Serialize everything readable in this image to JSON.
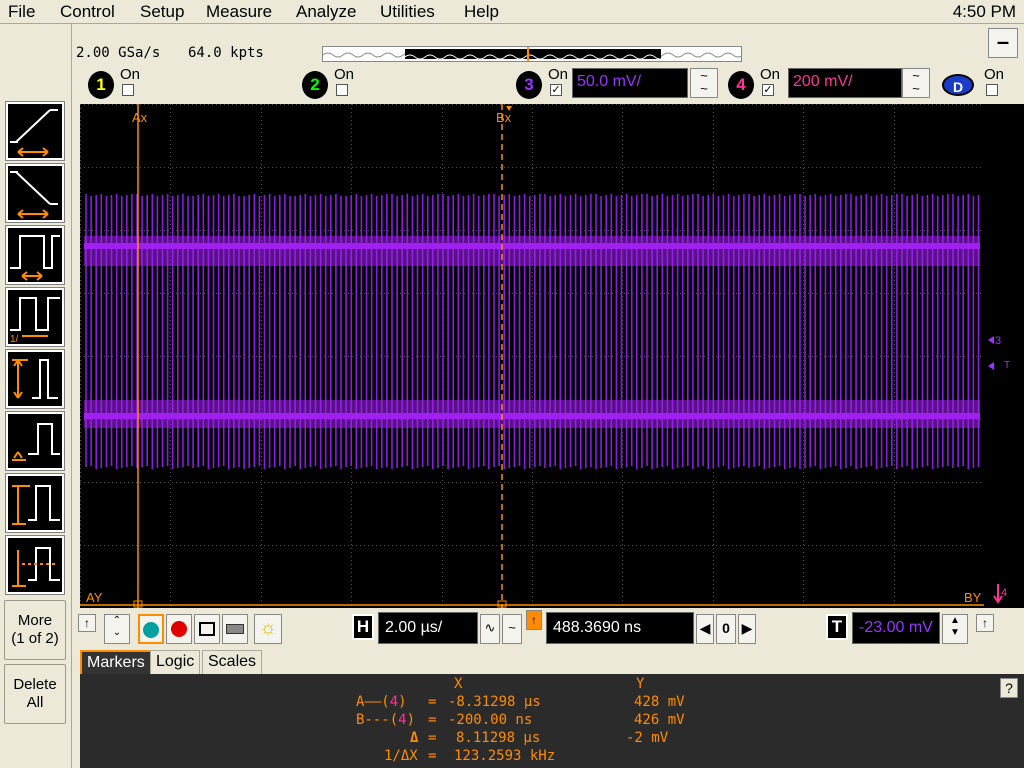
{
  "menu": {
    "items": [
      "File",
      "Control",
      "Setup",
      "Measure",
      "Analyze",
      "Utilities",
      "Help"
    ],
    "clock": "4:50 PM"
  },
  "acquisition": {
    "rate": "2.00 GSa/s",
    "points": "64.0 kpts",
    "minimize": "–"
  },
  "channels": [
    {
      "num": "1",
      "on_label": "On",
      "checked": false,
      "color": "#ffff00"
    },
    {
      "num": "2",
      "on_label": "On",
      "checked": false,
      "color": "#00ff00"
    },
    {
      "num": "3",
      "on_label": "On",
      "checked": true,
      "scale": "50.0 mV/",
      "color": "#9933ff"
    },
    {
      "num": "4",
      "on_label": "On",
      "checked": true,
      "scale": "200 mV/",
      "color": "#ff3399"
    }
  ],
  "digital": {
    "label": "D",
    "on_label": "On",
    "checked": false
  },
  "coupling_glyph": "~",
  "left_toolbar": {
    "modes": [
      "rising-edge-mode",
      "falling-edge-mode",
      "pulse-width-mode",
      "period-mode",
      "amplitude-mode",
      "base-level-mode",
      "top-level-mode",
      "threshold-mode"
    ],
    "more_label": "More\n(1 of 2)",
    "delete_label": "Delete\nAll"
  },
  "screen": {
    "ax_label": "Ax",
    "bx_label": "Bx",
    "ay_label": "AY",
    "by_label": "BY",
    "ch3_marker": "3",
    "trigger_marker": "T",
    "ch4_marker": "4",
    "colors": {
      "trace": "#8a1ce0",
      "trace_bright": "#a020f0",
      "cursor": "#ff8c00",
      "grid": "#505050"
    }
  },
  "horizontal": {
    "h_label": "H",
    "timebase": "2.00 µs/",
    "position": "488.3690 ns",
    "zoom_value": "0",
    "trigger_label": "T",
    "trigger_level": "-23.00 mV"
  },
  "tabs": [
    "Markers",
    "Logic",
    "Scales"
  ],
  "markers": {
    "col_x": "X",
    "col_y": "Y",
    "row_a": {
      "label": "A——(4)",
      "eq": "=",
      "x": "-8.31298 µs",
      "y": "428 mV"
    },
    "row_b": {
      "label": "B---(4)",
      "eq": "=",
      "x": "-200.00 ns",
      "y": "426 mV"
    },
    "row_delta": {
      "label": "Δ",
      "eq": "=",
      "x": "8.11298 µs",
      "y": "-2 mV"
    },
    "row_inv": {
      "label": "1/ΔX",
      "eq": "=",
      "x": "123.2593 kHz"
    },
    "help": "?"
  }
}
